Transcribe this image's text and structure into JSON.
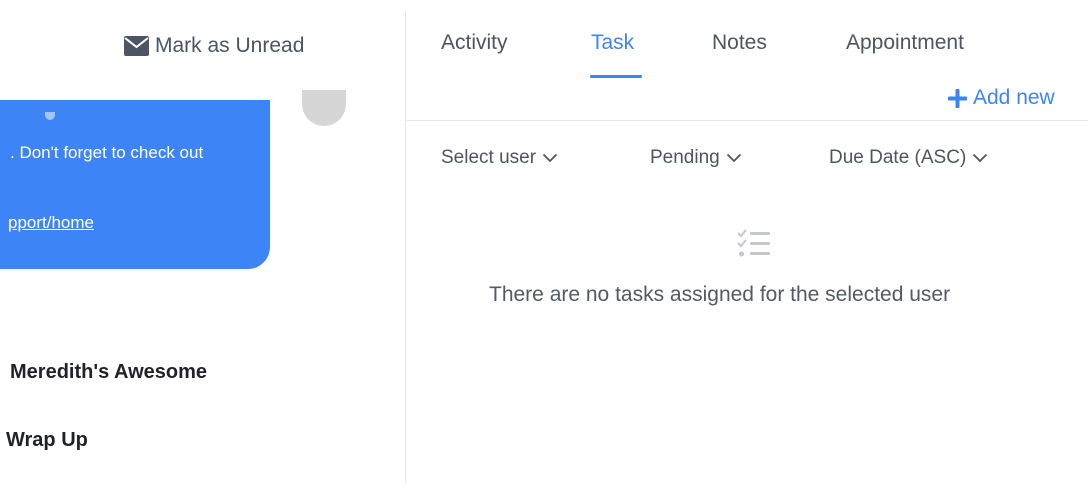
{
  "left_pane": {
    "mark_unread_label": "Mark as Unread",
    "icons": {
      "mark_unread": "envelope-icon"
    },
    "message_bubble": {
      "line": ". Don't forget to check out",
      "link": "pport/home",
      "color": "#3d85f7"
    },
    "conversations": [
      {
        "title": " Meredith's Awesome"
      },
      {
        "title": "Wrap Up"
      }
    ]
  },
  "tasks_pane": {
    "tabs": [
      {
        "label": "Activity",
        "active": false
      },
      {
        "label": "Task",
        "active": true
      },
      {
        "label": "Notes",
        "active": false
      },
      {
        "label": "Appointment",
        "active": false
      }
    ],
    "add_new_label": "Add new",
    "filters": {
      "user": "Select user",
      "status": "Pending",
      "sort": "Due Date (ASC)"
    },
    "empty_state": {
      "icon": "checklist-icon",
      "message": "There are no tasks assigned for the selected user"
    },
    "accent_color": "#3d85f7"
  }
}
